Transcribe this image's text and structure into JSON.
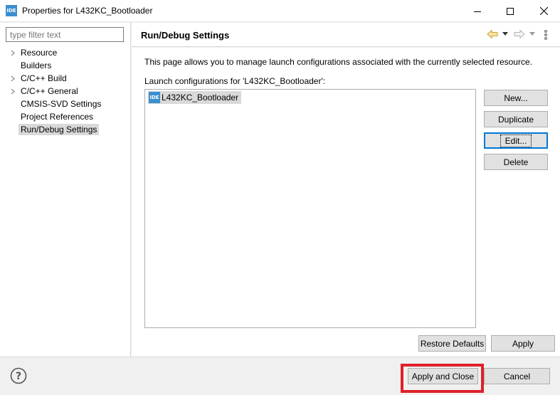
{
  "window": {
    "app_icon": "IDE",
    "title": "Properties for L432KC_Bootloader"
  },
  "filter": {
    "placeholder": "type filter text"
  },
  "tree": [
    {
      "label": "Resource",
      "expandable": true
    },
    {
      "label": "Builders",
      "expandable": false
    },
    {
      "label": "C/C++ Build",
      "expandable": true
    },
    {
      "label": "C/C++ General",
      "expandable": true
    },
    {
      "label": "CMSIS-SVD Settings",
      "expandable": false
    },
    {
      "label": "Project References",
      "expandable": false
    },
    {
      "label": "Run/Debug Settings",
      "expandable": false,
      "selected": true
    }
  ],
  "page": {
    "title": "Run/Debug Settings",
    "description": "This page allows you to manage launch configurations associated with the currently selected resource.",
    "list_label": "Launch configurations for 'L432KC_Bootloader':",
    "configurations": [
      "L432KC_Bootloader"
    ],
    "buttons": {
      "new": "New...",
      "duplicate": "Duplicate",
      "edit": "Edit...",
      "delete": "Delete"
    },
    "restore_defaults": "Restore Defaults",
    "apply": "Apply"
  },
  "bottom": {
    "apply_and_close": "Apply and Close",
    "cancel": "Cancel"
  },
  "colors": {
    "highlight": "#e0202a",
    "focus": "#0078d7",
    "ide_icon": "#3c8fce"
  }
}
